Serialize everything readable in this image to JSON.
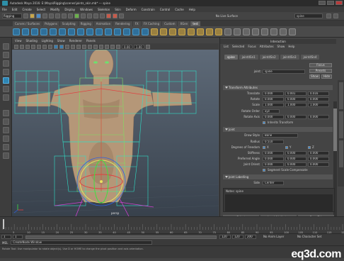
{
  "app": {
    "title": "Autodesk Maya 2016: E:\\Maya\\Rigging\\scenes\\joints_skin.mb* --- spine",
    "menus": [
      "File",
      "Edit",
      "Create",
      "Select",
      "Modify",
      "Display",
      "Windows",
      "Skeleton",
      "Skin",
      "Deform",
      "Constrain",
      "Control",
      "Cache",
      "Help"
    ]
  },
  "statusline": {
    "mode": "Rigging",
    "no_live": "No Live Surface",
    "search_value": "spine"
  },
  "shelf": {
    "tabs": [
      "Curves / Surfaces",
      "Polygons",
      "Sculpting",
      "Rigging",
      "Animation",
      "Rendering",
      "FX",
      "FX Caching",
      "Custom",
      "XGen",
      "test"
    ],
    "active_tab": "test"
  },
  "viewport": {
    "menus": [
      "View",
      "Shading",
      "Lighting",
      "Show",
      "Renderer",
      "Panels"
    ],
    "gamma_value": "0.00",
    "exposure_value": "1.00",
    "selected_joint_label": "persp"
  },
  "attribute_editor": {
    "panel_title": "Interaction",
    "menus": [
      "List",
      "Selected",
      "Focus",
      "Attributes",
      "Show",
      "Help"
    ],
    "tabs": [
      "spine",
      "joint4Sn1",
      "joint4Sn2",
      "joint4Sn3",
      "joint4Sn4"
    ],
    "active_tab": "spine",
    "node_label": "joint:",
    "node_name": "spine",
    "buttons": {
      "focus": "Focus",
      "presets": "Presets",
      "show": "Show",
      "hide": "Hide"
    },
    "transform_section": "Transform Attributes",
    "translate_label": "Translate",
    "translate": [
      "0.000",
      "0.001",
      "0.016"
    ],
    "rotate_label": "Rotate",
    "rotate": [
      "0.000",
      "0.000",
      "0.000"
    ],
    "scale_label": "Scale",
    "scale": [
      "1.000",
      "1.000",
      "1.000"
    ],
    "rotate_order_label": "Rotate Order",
    "rotate_order": "xyz",
    "rotate_axis_label": "Rotate Axis",
    "rotate_axis": [
      "0.000",
      "0.000",
      "0.000"
    ],
    "inherits_label": "Inherits Transform",
    "joint_section": "Joint",
    "draw_style_label": "Draw Style",
    "draw_style": "Bone",
    "radius_label": "Radius",
    "radius": "0.510",
    "dof_label": "Degrees of Freedom",
    "dof": [
      "X",
      "Y",
      "Z"
    ],
    "stiffness_label": "Stiffness",
    "stiffness": [
      "0.000",
      "0.000",
      "0.000"
    ],
    "preferred_label": "Preferred Angle",
    "preferred": [
      "0.000",
      "0.000",
      "0.000"
    ],
    "orient_label": "Joint Orient",
    "orient": [
      "0.000",
      "0.000",
      "0.000"
    ],
    "ssc_label": "Segment Scale Compensate",
    "labelling_section": "Joint Labelling",
    "side_label": "Side",
    "side": "Center",
    "notes_label": "Notes:  spine",
    "bottom_buttons": [
      "Select",
      "Load Attributes",
      "Copy Tab"
    ]
  },
  "timeline": {
    "ticks": [
      "5",
      "10",
      "15",
      "20",
      "25",
      "30",
      "35",
      "40",
      "45",
      "50",
      "55",
      "60",
      "65",
      "70",
      "75",
      "80",
      "85",
      "90",
      "95",
      "100",
      "105",
      "110",
      "115",
      "120"
    ],
    "current": "1"
  },
  "rangebar": {
    "start": "1",
    "start2": "1",
    "end": "120",
    "end2": "120",
    "end3": "200",
    "anim_layer": "No Anim Layer",
    "char_set": "No Character Set"
  },
  "cmdline": {
    "lang": "MEL",
    "text": "CreateNode.Window"
  },
  "helpline": {
    "text": "Rotate Tool: Use manipulator to rotate object(s). Use D or HOME to change the pivot position and axis orientation."
  },
  "watermark": {
    "text": "eq3d.com"
  }
}
